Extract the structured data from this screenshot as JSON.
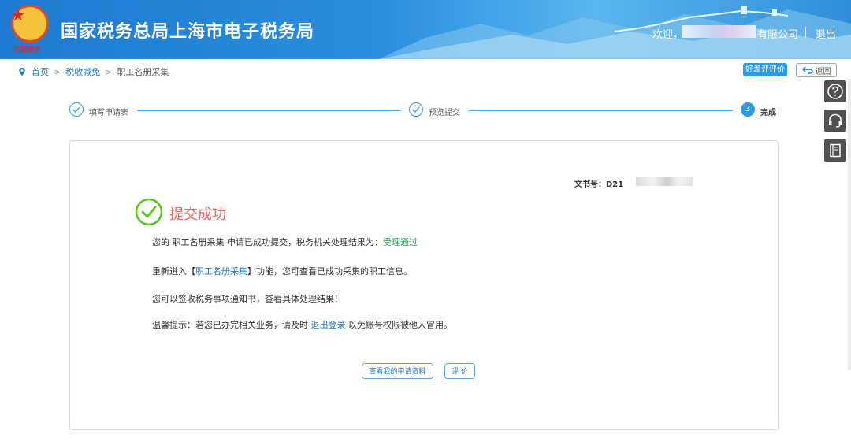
{
  "header": {
    "site_title": "国家税务总局上海市电子税务局",
    "emblem_text": "中国税务",
    "welcome_prefix": "欢迎，",
    "company_suffix": "有限公司",
    "separator": "|",
    "logout_label": "退出"
  },
  "breadcrumb": {
    "home": "首页",
    "section": "税收减免",
    "current": "职工名册采集",
    "sep": ">"
  },
  "actions": {
    "rate_label": "好差评评价",
    "back_label": "返回"
  },
  "steps": [
    {
      "label": "填写申请表",
      "state": "done"
    },
    {
      "label": "预览提交",
      "state": "done"
    },
    {
      "label": "完成",
      "number": "3",
      "state": "current"
    }
  ],
  "result": {
    "doc_no_label": "文书号：D21",
    "title": "提交成功",
    "line1_pre": "您的 职工名册采集 申请已成功提交，税务机关处理结果为：",
    "line1_status": "受理通过",
    "line2_pre": "重新进入【",
    "line2_link": "职工名册采集",
    "line2_post": "】功能，您可查看已成功采集的职工信息。",
    "line3": "您可以签收税务事项通知书，查看具体处理结果！",
    "line4_pre": "温馨提示：若您已办完相关业务，请及时 ",
    "line4_link": "退出登录",
    "line4_post": " 以免账号权限被他人冒用。",
    "view_button": "查看我的申请资料",
    "rate_button": "评 价"
  },
  "colors": {
    "primary": "#2b9be8",
    "success": "#52c41a",
    "title_red": "#e86b5f",
    "status_green": "#2aa55a"
  },
  "icons": [
    "location-pin-icon",
    "check-circle-icon",
    "back-arrow-icon",
    "help-icon",
    "headset-icon",
    "book-icon"
  ]
}
